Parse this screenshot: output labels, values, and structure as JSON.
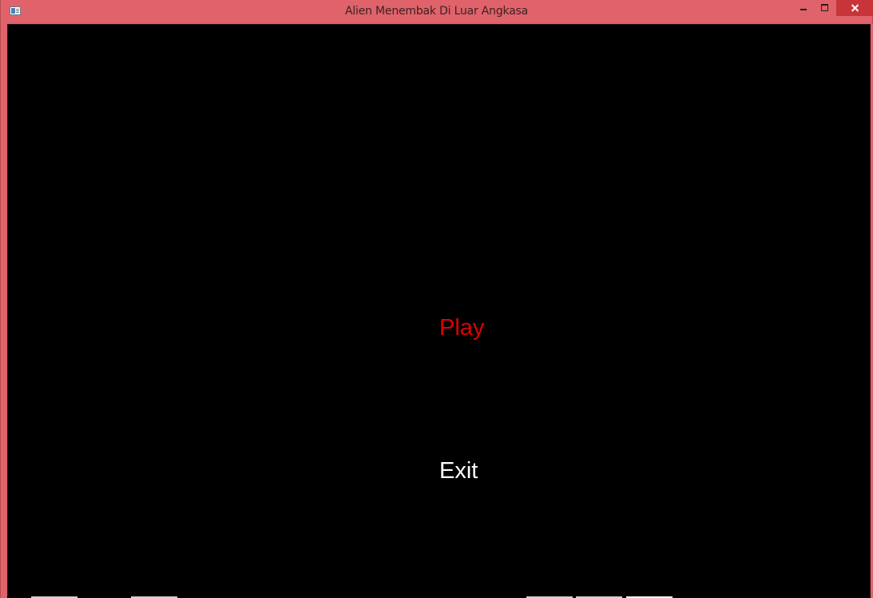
{
  "window": {
    "title": "Alien Menembak Di Luar Angkasa",
    "titlebar_color": "#e0626a",
    "close_button_color": "#c7353b"
  },
  "menu": {
    "play_label": "Play",
    "exit_label": "Exit",
    "play_color": "#e00000",
    "exit_color": "#ffffff"
  },
  "icons": [
    "app-icon",
    "minimize-icon",
    "maximize-icon",
    "close-icon"
  ]
}
